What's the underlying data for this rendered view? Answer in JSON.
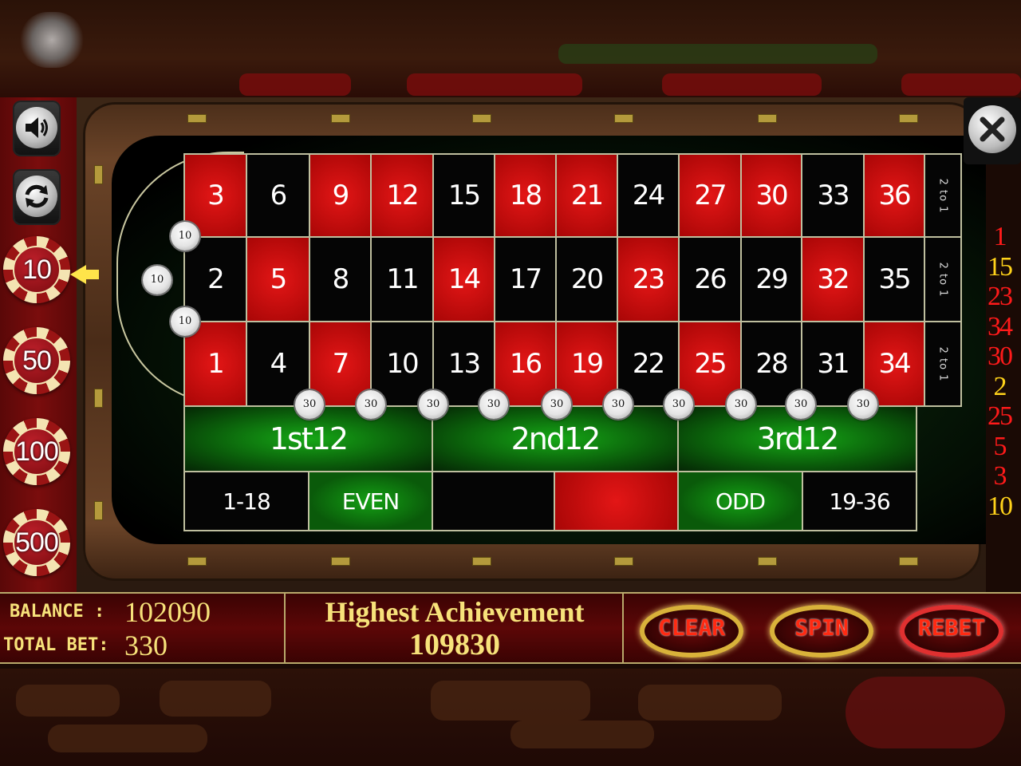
{
  "colors": {
    "red": "#c80a0a",
    "black": "#050505",
    "green": "#128a12",
    "gold": "#f7e27a"
  },
  "left_panel": {
    "sound_button": {
      "icon": "speaker-icon"
    },
    "rebet_toggle": {
      "icon": "refresh-icon"
    },
    "chips": [
      "10",
      "50",
      "100",
      "500"
    ],
    "selected_chip": "10"
  },
  "close_button": {
    "icon": "close-icon"
  },
  "table": {
    "rows": [
      [
        {
          "n": "3",
          "c": "red"
        },
        {
          "n": "6",
          "c": "black"
        },
        {
          "n": "9",
          "c": "red"
        },
        {
          "n": "12",
          "c": "red"
        },
        {
          "n": "15",
          "c": "black"
        },
        {
          "n": "18",
          "c": "red"
        },
        {
          "n": "21",
          "c": "red"
        },
        {
          "n": "24",
          "c": "black"
        },
        {
          "n": "27",
          "c": "red"
        },
        {
          "n": "30",
          "c": "red"
        },
        {
          "n": "33",
          "c": "black"
        },
        {
          "n": "36",
          "c": "red"
        }
      ],
      [
        {
          "n": "2",
          "c": "black"
        },
        {
          "n": "5",
          "c": "red"
        },
        {
          "n": "8",
          "c": "black"
        },
        {
          "n": "11",
          "c": "black"
        },
        {
          "n": "14",
          "c": "red"
        },
        {
          "n": "17",
          "c": "black"
        },
        {
          "n": "20",
          "c": "black"
        },
        {
          "n": "23",
          "c": "red"
        },
        {
          "n": "26",
          "c": "black"
        },
        {
          "n": "29",
          "c": "black"
        },
        {
          "n": "32",
          "c": "red"
        },
        {
          "n": "35",
          "c": "black"
        }
      ],
      [
        {
          "n": "1",
          "c": "red"
        },
        {
          "n": "4",
          "c": "black"
        },
        {
          "n": "7",
          "c": "red"
        },
        {
          "n": "10",
          "c": "black"
        },
        {
          "n": "13",
          "c": "black"
        },
        {
          "n": "16",
          "c": "red"
        },
        {
          "n": "19",
          "c": "red"
        },
        {
          "n": "22",
          "c": "black"
        },
        {
          "n": "25",
          "c": "red"
        },
        {
          "n": "28",
          "c": "black"
        },
        {
          "n": "31",
          "c": "black"
        },
        {
          "n": "34",
          "c": "red"
        }
      ]
    ],
    "column_bets": [
      "2 to 1",
      "2 to 1",
      "2 to 1"
    ],
    "dozens": [
      "1st12",
      "2nd12",
      "3rd12"
    ],
    "outside_bets": [
      "1-18",
      "EVEN",
      "",
      "",
      "ODD",
      "19-36"
    ]
  },
  "placed_chips": {
    "zero_area": [
      "10",
      "10",
      "10"
    ],
    "street_row": [
      "30",
      "30",
      "30",
      "30",
      "30",
      "30",
      "30",
      "30",
      "30",
      "30"
    ]
  },
  "history": [
    {
      "v": "1",
      "c": "red"
    },
    {
      "v": "15",
      "c": "yellow"
    },
    {
      "v": "23",
      "c": "red"
    },
    {
      "v": "34",
      "c": "red"
    },
    {
      "v": "30",
      "c": "red"
    },
    {
      "v": "2",
      "c": "yellow"
    },
    {
      "v": "25",
      "c": "red"
    },
    {
      "v": "5",
      "c": "red"
    },
    {
      "v": "3",
      "c": "red"
    },
    {
      "v": "10",
      "c": "yellow"
    }
  ],
  "stats": {
    "balance_label": "BALANCE :",
    "balance": "102090",
    "total_bet_label": "TOTAL BET:",
    "total_bet": "330",
    "highest_label": "Highest Achievement",
    "highest": "109830"
  },
  "buttons": {
    "clear": "CLEAR",
    "spin": "SPIN",
    "rebet": "REBET"
  }
}
